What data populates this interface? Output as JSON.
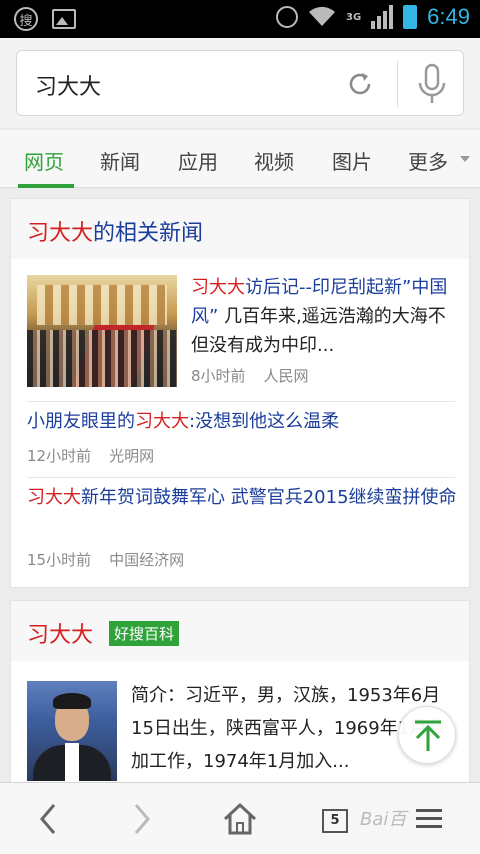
{
  "statusbar": {
    "time": "6:49",
    "network": "3G",
    "left_icon_text": "搜"
  },
  "search": {
    "query": "习大大"
  },
  "tabs": [
    {
      "label": "网页",
      "active": true
    },
    {
      "label": "新闻",
      "active": false
    },
    {
      "label": "应用",
      "active": false
    },
    {
      "label": "视频",
      "active": false
    },
    {
      "label": "图片",
      "active": false
    },
    {
      "label": "更多",
      "active": false
    }
  ],
  "news_card": {
    "title_highlight": "习大大",
    "title_rest": "的相关新闻",
    "items": [
      {
        "highlight": "习大大",
        "headline": "访后记--印尼刮起新”中国风”",
        "snippet": " 几百年来,遥远浩瀚的大海不但没有成为中印...",
        "time": "8小时前",
        "source": "人民网"
      },
      {
        "prefix": "小朋友眼里的",
        "highlight": "习大大",
        "suffix": ":没想到他这么温柔",
        "time": "12小时前",
        "source": "光明网"
      },
      {
        "highlight": "习大大",
        "suffix": "新年贺词鼓舞军心 武警官兵2015继续蛮拼使命",
        "time": "15小时前",
        "source": "中国经济网"
      }
    ]
  },
  "baike_card": {
    "title": "习大大",
    "badge": "好搜百科",
    "intro": "简介：习近平，男，汉族，1953年6月15日出生，陕西富平人，1969年1月参加工作，1974年1月加入..."
  },
  "bottom_bar": {
    "tab_count": "5",
    "watermark": "Bai百"
  },
  "colors": {
    "accent_green": "#2fa33a",
    "link_blue": "#1b3e9c",
    "highlight_red": "#d71e1e",
    "status_blue": "#33b5e5"
  }
}
